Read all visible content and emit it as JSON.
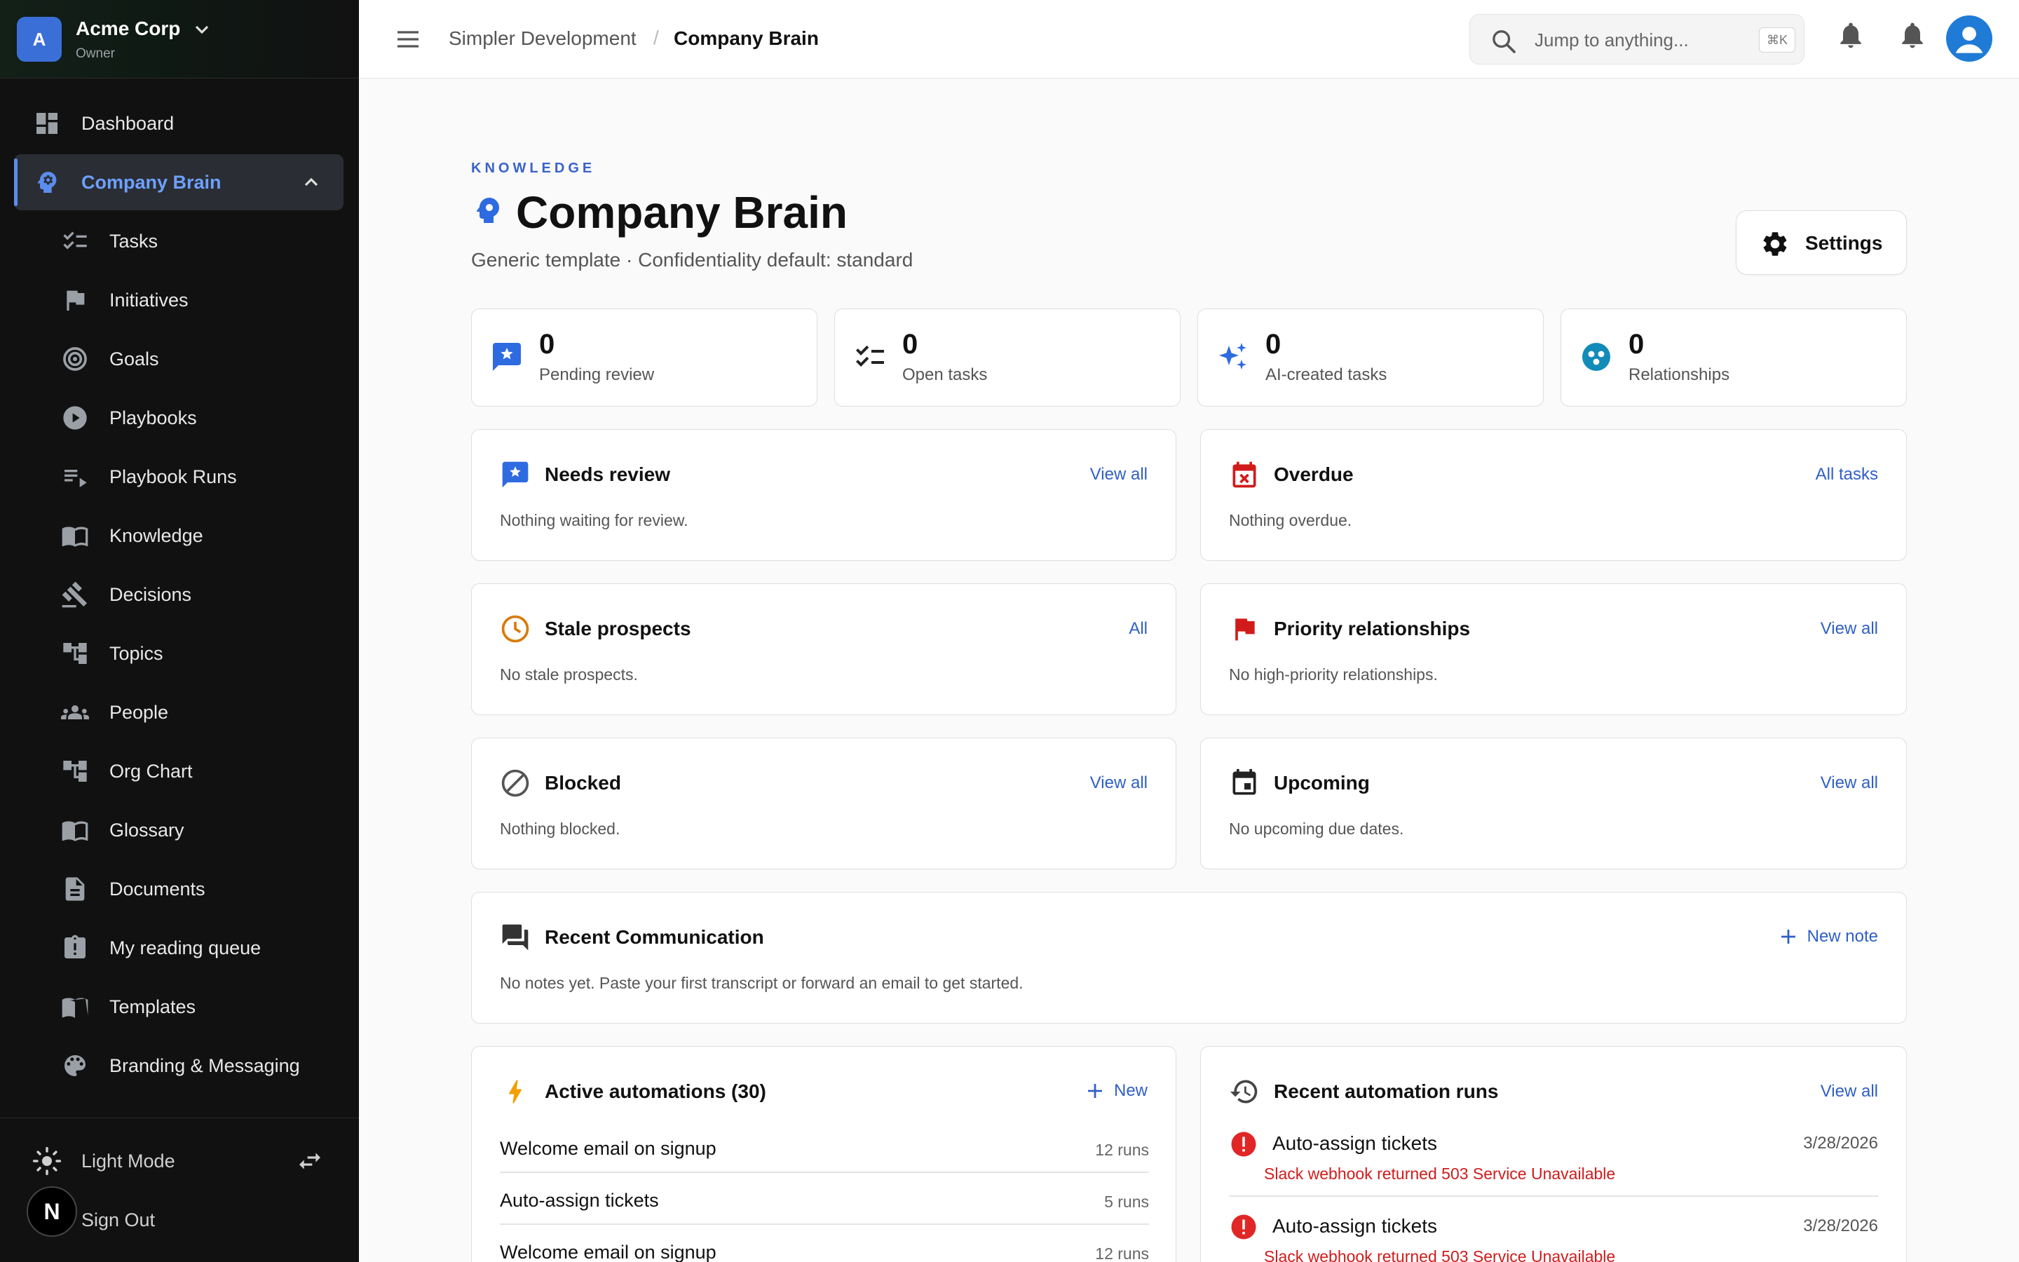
{
  "org": {
    "initial": "A",
    "name": "Acme Corp",
    "role": "Owner"
  },
  "sidebar": {
    "items": [
      {
        "label": "Dashboard",
        "icon": "dashboard-icon"
      },
      {
        "label": "Company Brain",
        "icon": "brain-icon",
        "active": true,
        "expanded": true
      },
      {
        "label": "Tasks",
        "icon": "checklist-icon"
      },
      {
        "label": "Initiatives",
        "icon": "flag-icon"
      },
      {
        "label": "Goals",
        "icon": "target-icon"
      },
      {
        "label": "Playbooks",
        "icon": "play-icon"
      },
      {
        "label": "Playbook Runs",
        "icon": "playlist-play-icon"
      },
      {
        "label": "Knowledge",
        "icon": "book-icon"
      },
      {
        "label": "Decisions",
        "icon": "gavel-icon"
      },
      {
        "label": "Topics",
        "icon": "tree-icon"
      },
      {
        "label": "People",
        "icon": "people-icon"
      },
      {
        "label": "Org Chart",
        "icon": "org-chart-icon"
      },
      {
        "label": "Glossary",
        "icon": "book-icon"
      },
      {
        "label": "Documents",
        "icon": "document-icon"
      },
      {
        "label": "My reading queue",
        "icon": "reading-queue-icon"
      },
      {
        "label": "Templates",
        "icon": "open-book-icon"
      },
      {
        "label": "Branding & Messaging",
        "icon": "palette-icon"
      }
    ],
    "light_mode_label": "Light Mode",
    "sign_out_label": "Sign Out",
    "badge_letter": "N"
  },
  "header": {
    "breadcrumb_parent": "Simpler Development",
    "breadcrumb_sep": "/",
    "breadcrumb_current": "Company Brain",
    "search_placeholder": "Jump to anything...",
    "search_shortcut": "⌘K"
  },
  "page": {
    "eyebrow": "KNOWLEDGE",
    "title": "Company Brain",
    "subtitle": "Generic template · Confidentiality default: standard",
    "settings_label": "Settings"
  },
  "stats": [
    {
      "value": "0",
      "label": "Pending review",
      "icon": "review-icon"
    },
    {
      "value": "0",
      "label": "Open tasks",
      "icon": "checklist-icon"
    },
    {
      "value": "0",
      "label": "AI-created tasks",
      "icon": "sparkle-icon"
    },
    {
      "value": "0",
      "label": "Relationships",
      "icon": "relationships-icon"
    }
  ],
  "panels": {
    "needs_review": {
      "title": "Needs review",
      "link": "View all",
      "empty": "Nothing waiting for review."
    },
    "overdue": {
      "title": "Overdue",
      "link": "All tasks",
      "empty": "Nothing overdue."
    },
    "stale_prospects": {
      "title": "Stale prospects",
      "link": "All",
      "empty": "No stale prospects."
    },
    "priority_relationships": {
      "title": "Priority relationships",
      "link": "View all",
      "empty": "No high-priority relationships."
    },
    "blocked": {
      "title": "Blocked",
      "link": "View all",
      "empty": "Nothing blocked."
    },
    "upcoming": {
      "title": "Upcoming",
      "link": "View all",
      "empty": "No upcoming due dates."
    },
    "recent_communication": {
      "title": "Recent Communication",
      "link": "New note",
      "empty": "No notes yet. Paste your first transcript or forward an email to get started."
    }
  },
  "automations": {
    "title": "Active automations (30)",
    "new_label": "New",
    "rows": [
      {
        "name": "Welcome email on signup",
        "runs": "12 runs"
      },
      {
        "name": "Auto-assign tickets",
        "runs": "5 runs"
      },
      {
        "name": "Welcome email on signup",
        "runs": "12 runs"
      }
    ]
  },
  "runs": {
    "title": "Recent automation runs",
    "link": "View all",
    "rows": [
      {
        "name": "Auto-assign tickets",
        "date": "3/28/2026",
        "error": "Slack webhook returned 503 Service Unavailable"
      },
      {
        "name": "Auto-assign tickets",
        "date": "3/28/2026",
        "error": "Slack webhook returned 503 Service Unavailable"
      }
    ]
  },
  "colors": {
    "accent": "#2f5fc6",
    "sidebar_bg": "#111111",
    "error": "#d11b1b",
    "active_nav": "#6ea0ff"
  }
}
